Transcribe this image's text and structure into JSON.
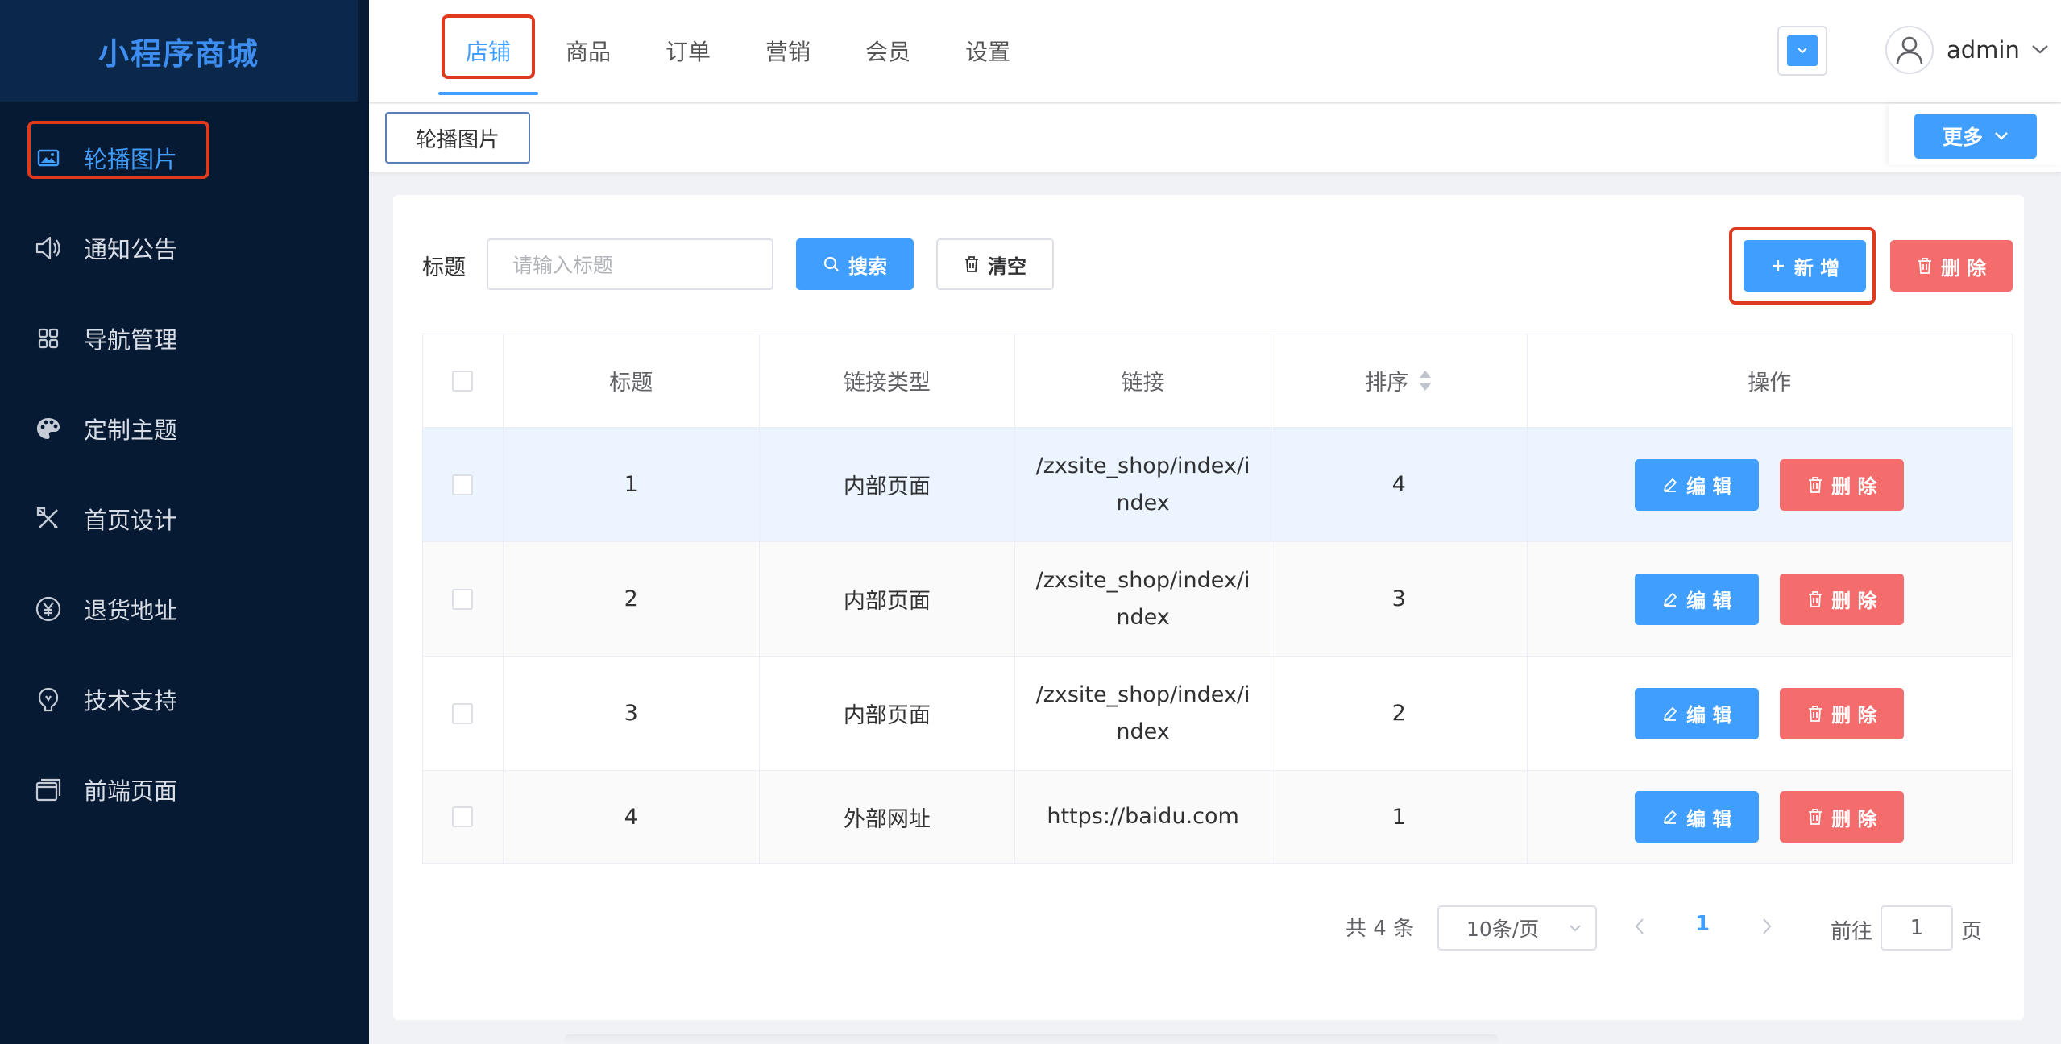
{
  "app": {
    "title": "小程序商城"
  },
  "sidebar": {
    "items": [
      {
        "label": "轮播图片",
        "icon": "image-icon",
        "active": true
      },
      {
        "label": "通知公告",
        "icon": "speaker-icon",
        "active": false
      },
      {
        "label": "导航管理",
        "icon": "grid-icon",
        "active": false
      },
      {
        "label": "定制主题",
        "icon": "palette-icon",
        "active": false
      },
      {
        "label": "首页设计",
        "icon": "design-tools-icon",
        "active": false
      },
      {
        "label": "退货地址",
        "icon": "yen-icon",
        "active": false
      },
      {
        "label": "技术支持",
        "icon": "support-icon",
        "active": false
      },
      {
        "label": "前端页面",
        "icon": "pages-icon",
        "active": false
      }
    ]
  },
  "header": {
    "tabs": [
      {
        "label": "店铺",
        "active": true
      },
      {
        "label": "商品",
        "active": false
      },
      {
        "label": "订单",
        "active": false
      },
      {
        "label": "营销",
        "active": false
      },
      {
        "label": "会员",
        "active": false
      },
      {
        "label": "设置",
        "active": false
      }
    ],
    "user": {
      "name": "admin"
    }
  },
  "tagbar": {
    "tag_label": "轮播图片",
    "more_label": "更多"
  },
  "filter": {
    "title_label": "标题",
    "title_placeholder": "请输入标题",
    "search_label": "搜索",
    "clear_label": "清空",
    "add_label": "新 增",
    "delete_label": "删 除"
  },
  "table": {
    "columns": [
      "标题",
      "链接类型",
      "链接",
      "排序",
      "操作"
    ],
    "rows": [
      {
        "title": "1",
        "link_type": "内部页面",
        "link": "/zxsite_shop/index/index",
        "sort": "4"
      },
      {
        "title": "2",
        "link_type": "内部页面",
        "link": "/zxsite_shop/index/index",
        "sort": "3"
      },
      {
        "title": "3",
        "link_type": "内部页面",
        "link": "/zxsite_shop/index/index",
        "sort": "2"
      },
      {
        "title": "4",
        "link_type": "外部网址",
        "link": "https://baidu.com",
        "sort": "1"
      }
    ],
    "edit_label": "编 辑",
    "delete_label": "删 除"
  },
  "pagination": {
    "total": "共 4 条",
    "page_size": "10条/页",
    "current_page": "1",
    "goto_label": "前往",
    "goto_value": "1",
    "page_suffix": "页"
  },
  "colors": {
    "sidebar_bg": "#071a33",
    "primary": "#409eff",
    "danger": "#f56c6c",
    "highlight_box": "#e03a1e"
  }
}
